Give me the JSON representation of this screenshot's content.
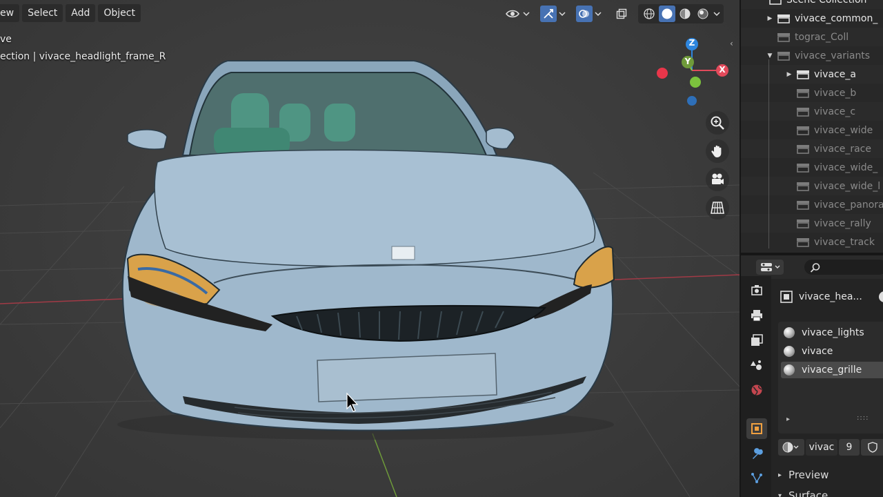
{
  "header": {
    "menus": [
      "ew",
      "Select",
      "Add",
      "Object"
    ]
  },
  "viewport": {
    "mode_text": "ve",
    "collection_text": "ection | vivace_headlight_frame_R",
    "gizmo_labels": {
      "z": "Z",
      "y": "Y",
      "x": "X"
    },
    "nav_icons": [
      "zoom-icon",
      "hand-pan-icon",
      "camera-icon",
      "grid-perspective-icon"
    ],
    "colors": {
      "x_axis": "#e24a5b",
      "y_axis": "#8bc34a",
      "z_axis": "#2e86de",
      "car_body": "#9fb8cc"
    }
  },
  "outliner": {
    "items": [
      {
        "label": "Scene Collection",
        "indent": 0,
        "expand": "",
        "dim": false
      },
      {
        "label": "vivace_common_",
        "indent": 1,
        "expand": "closed",
        "dim": false
      },
      {
        "label": "tograc_Coll",
        "indent": 1,
        "expand": "",
        "dim": true
      },
      {
        "label": "vivace_variants",
        "indent": 1,
        "expand": "open",
        "dim": true
      },
      {
        "label": "vivace_a",
        "indent": 2,
        "expand": "closed",
        "dim": false
      },
      {
        "label": "vivace_b",
        "indent": 2,
        "expand": "",
        "dim": true
      },
      {
        "label": "vivace_c",
        "indent": 2,
        "expand": "",
        "dim": true
      },
      {
        "label": "vivace_wide",
        "indent": 2,
        "expand": "",
        "dim": true
      },
      {
        "label": "vivace_race",
        "indent": 2,
        "expand": "",
        "dim": true
      },
      {
        "label": "vivace_wide_",
        "indent": 2,
        "expand": "",
        "dim": true
      },
      {
        "label": "vivace_wide_l",
        "indent": 2,
        "expand": "",
        "dim": true
      },
      {
        "label": "vivace_panora",
        "indent": 2,
        "expand": "",
        "dim": true
      },
      {
        "label": "vivace_rally",
        "indent": 2,
        "expand": "",
        "dim": true
      },
      {
        "label": "vivace_track",
        "indent": 2,
        "expand": "",
        "dim": true
      }
    ]
  },
  "properties": {
    "object_name": "vivace_hea...",
    "materials": [
      {
        "label": "vivace_lights",
        "selected": false
      },
      {
        "label": "vivace",
        "selected": false
      },
      {
        "label": "vivace_grille",
        "selected": true
      }
    ],
    "list_expand": "▸",
    "list_grip": "::::",
    "material_field": "vivac",
    "user_count": "9",
    "panels": [
      "Preview",
      "Surface"
    ]
  }
}
